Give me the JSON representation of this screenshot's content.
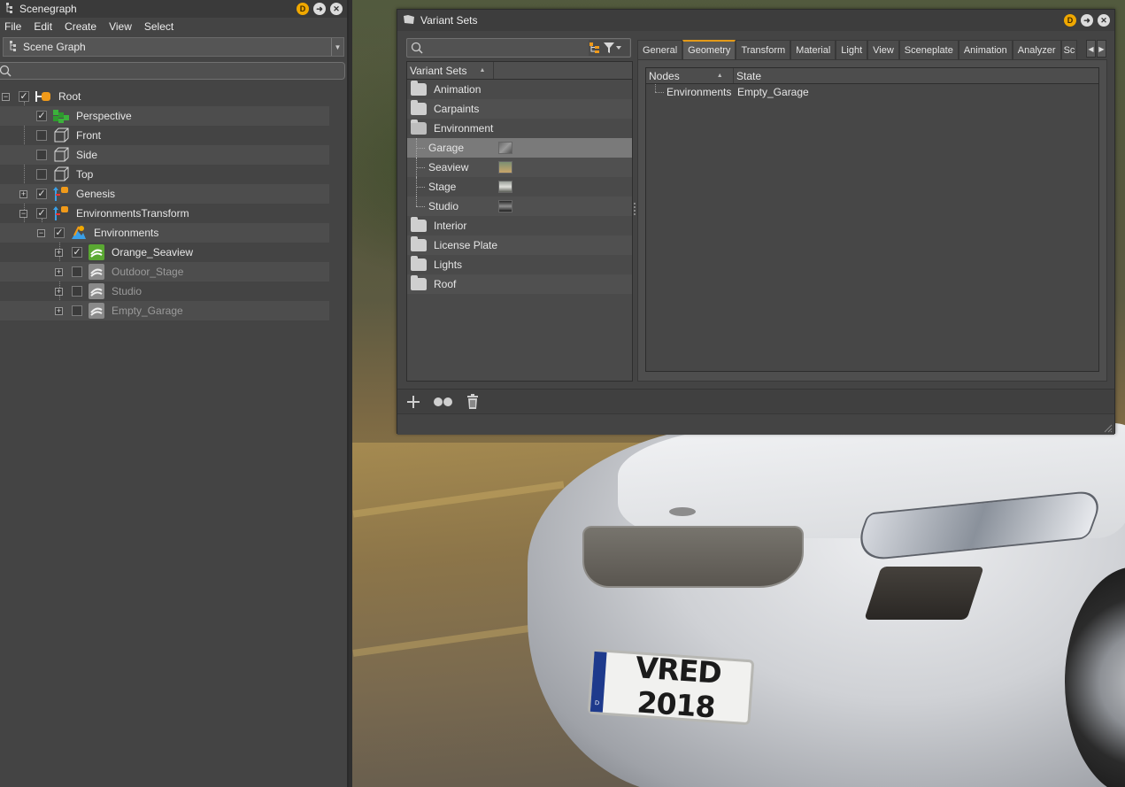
{
  "scenegraph": {
    "title": "Scenegraph",
    "badge": "D",
    "menu": [
      "File",
      "Edit",
      "Create",
      "View",
      "Select"
    ],
    "view_selector": "Scene Graph",
    "search_placeholder": "",
    "nodes": [
      {
        "name": "Root",
        "checked": true,
        "icon": "group-icon",
        "expander": "minus"
      },
      {
        "name": "Perspective",
        "checked": true,
        "icon": "perspective-camera-icon"
      },
      {
        "name": "Front",
        "checked": false,
        "icon": "ortho-camera-icon"
      },
      {
        "name": "Side",
        "checked": false,
        "icon": "ortho-camera-icon"
      },
      {
        "name": "Top",
        "checked": false,
        "icon": "ortho-camera-icon"
      },
      {
        "name": "Genesis",
        "checked": true,
        "icon": "transform-icon",
        "expander": "plus"
      },
      {
        "name": "EnvironmentsTransform",
        "checked": true,
        "icon": "transform-icon",
        "expander": "minus"
      },
      {
        "name": "Environments",
        "checked": true,
        "icon": "environment-switch-icon",
        "expander": "minus"
      },
      {
        "name": "Orange_Seaview",
        "checked": true,
        "icon": "environment-sphere-icon",
        "expander": "plus"
      },
      {
        "name": "Outdoor_Stage",
        "checked": false,
        "icon": "environment-sphere-icon",
        "expander": "plus"
      },
      {
        "name": "Studio",
        "checked": false,
        "icon": "environment-sphere-icon",
        "expander": "plus"
      },
      {
        "name": "Empty_Garage",
        "checked": false,
        "icon": "environment-sphere-icon",
        "expander": "plus"
      }
    ]
  },
  "variant_sets": {
    "title": "Variant Sets",
    "badge": "D",
    "search_placeholder": "",
    "list_header": "Variant Sets",
    "items": [
      {
        "label": "Animation",
        "type": "folder"
      },
      {
        "label": "Carpaints",
        "type": "folder"
      },
      {
        "label": "Environment",
        "type": "folder-open"
      },
      {
        "label": "Garage",
        "type": "variant",
        "selected": true
      },
      {
        "label": "Seaview",
        "type": "variant"
      },
      {
        "label": "Stage",
        "type": "variant"
      },
      {
        "label": "Studio",
        "type": "variant"
      },
      {
        "label": "Interior",
        "type": "folder"
      },
      {
        "label": "License Plate",
        "type": "folder"
      },
      {
        "label": "Lights",
        "type": "folder"
      },
      {
        "label": "Roof",
        "type": "folder"
      }
    ],
    "tabs": [
      "General",
      "Geometry",
      "Transform",
      "Material",
      "Light",
      "View",
      "Sceneplate",
      "Animation",
      "Analyzer",
      "Sc"
    ],
    "active_tab": "Geometry",
    "table_headers": {
      "nodes": "Nodes",
      "state": "State"
    },
    "rows": [
      {
        "node": "Environments",
        "state": "Empty_Garage"
      }
    ]
  },
  "viewport": {
    "plate_text": "VRED 2018",
    "plate_country": "D"
  },
  "colors": {
    "accent": "#e39a18",
    "panel": "#444444",
    "selection": "#7a7a7a"
  }
}
